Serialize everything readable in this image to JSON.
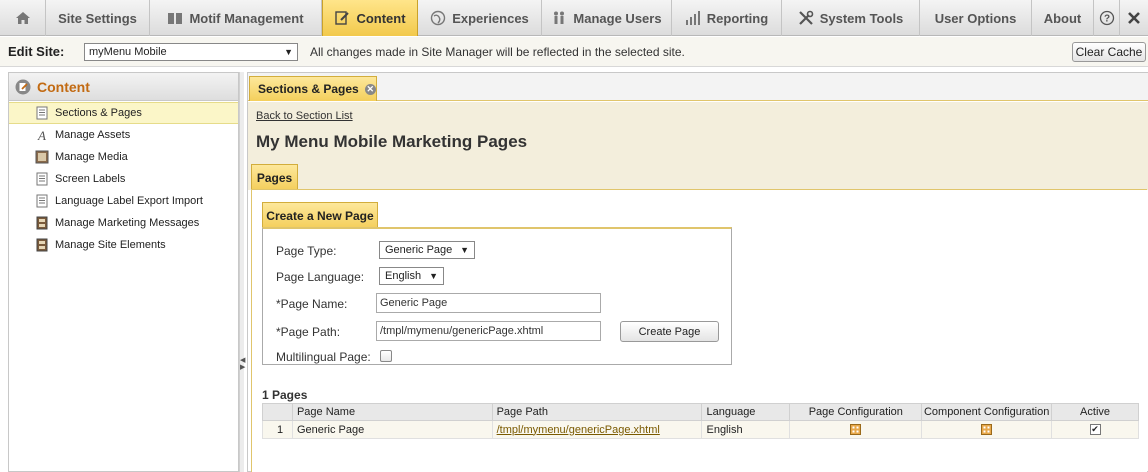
{
  "nav": {
    "items": [
      {
        "label": "",
        "icon": "home-icon"
      },
      {
        "label": "Site Settings",
        "icon": ""
      },
      {
        "label": "Motif Management",
        "icon": "book-icon"
      },
      {
        "label": "Content",
        "icon": "edit-icon",
        "active": true
      },
      {
        "label": "Experiences",
        "icon": "globe-icon"
      },
      {
        "label": "Manage Users",
        "icon": "users-icon"
      },
      {
        "label": "Reporting",
        "icon": "bar-chart-icon"
      },
      {
        "label": "System Tools",
        "icon": "tools-icon"
      },
      {
        "label": "User Options",
        "icon": ""
      },
      {
        "label": "About",
        "icon": ""
      },
      {
        "label": "?",
        "icon": "help-icon"
      },
      {
        "label": "",
        "icon": "close-icon"
      }
    ]
  },
  "sitebar": {
    "label": "Edit Site:",
    "selected_site": "myMenu Mobile",
    "note": "All changes made in Site Manager will be reflected in the selected site.",
    "clear_cache": "Clear Cache"
  },
  "sidebar": {
    "title": "Content",
    "items": [
      {
        "label": "Sections & Pages",
        "icon": "document-icon",
        "selected": true
      },
      {
        "label": "Manage Assets",
        "icon": "font-icon"
      },
      {
        "label": "Manage Media",
        "icon": "media-icon"
      },
      {
        "label": "Screen Labels",
        "icon": "document-icon"
      },
      {
        "label": "Language Label Export Import",
        "icon": "document-icon"
      },
      {
        "label": "Manage Marketing Messages",
        "icon": "cabinet-icon"
      },
      {
        "label": "Manage Site Elements",
        "icon": "cabinet-icon"
      }
    ]
  },
  "main": {
    "tab_label": "Sections & Pages",
    "back_link": "Back to Section List",
    "page_title": "My Menu Mobile Marketing Pages",
    "sub_tab": "Pages",
    "create": {
      "tab_label": "Create a New Page",
      "page_type_label": "Page Type:",
      "page_type_value": "Generic Page",
      "page_language_label": "Page Language:",
      "page_language_value": "English",
      "page_name_label": "*Page Name:",
      "page_name_value": "Generic Page",
      "page_path_label": "*Page Path:",
      "page_path_value": "/tmpl/mymenu/genericPage.xhtml",
      "create_button": "Create Page",
      "multilingual_label": "Multilingual Page:",
      "multilingual_checked": false
    },
    "pages_count": "1 Pages",
    "table": {
      "headers": [
        "",
        "Page Name",
        "Page Path",
        "Language",
        "Page Configuration",
        "Component Configuration",
        "Active"
      ],
      "rows": [
        {
          "num": "1",
          "name": "Generic Page",
          "path": "/tmpl/mymenu/genericPage.xhtml",
          "language": "English",
          "active": true
        }
      ]
    }
  },
  "colors": {
    "accent": "#f4cf5c",
    "section_bg": "#f3eedc",
    "sidebar_title": "#c26a12"
  }
}
